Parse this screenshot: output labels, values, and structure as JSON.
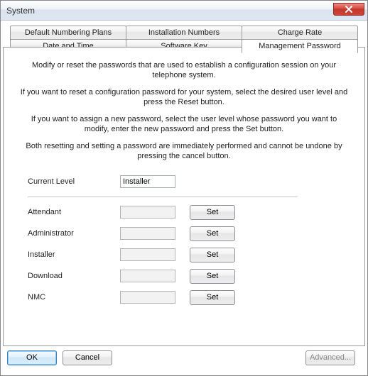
{
  "window": {
    "title": "System"
  },
  "tabs": {
    "row1": [
      {
        "label": "Default Numbering Plans"
      },
      {
        "label": "Installation Numbers"
      },
      {
        "label": "Charge Rate"
      }
    ],
    "row2": [
      {
        "label": "Date and Time"
      },
      {
        "label": "Software Key"
      },
      {
        "label": "Management Password"
      }
    ]
  },
  "intro": {
    "p1": "Modify or reset the passwords that are used to establish a configuration session on your telephone system.",
    "p2": "If you want to reset a configuration password for your system, select the desired user level and press the Reset button.",
    "p3": "If you want to assign a new password, select the user level whose password you want to modify, enter the new password and press the Set button.",
    "p4": "Both resetting and setting a password are immediately performed and cannot be undone by pressing the cancel button."
  },
  "form": {
    "current_level_label": "Current Level",
    "current_level_value": "Installer",
    "rows": [
      {
        "label": "Attendant",
        "value": "",
        "btn": "Set"
      },
      {
        "label": "Administrator",
        "value": "",
        "btn": "Set"
      },
      {
        "label": "Installer",
        "value": "",
        "btn": "Set"
      },
      {
        "label": "Download",
        "value": "",
        "btn": "Set"
      },
      {
        "label": "NMC",
        "value": "",
        "btn": "Set"
      }
    ]
  },
  "buttons": {
    "ok": "OK",
    "cancel": "Cancel",
    "advanced": "Advanced..."
  }
}
